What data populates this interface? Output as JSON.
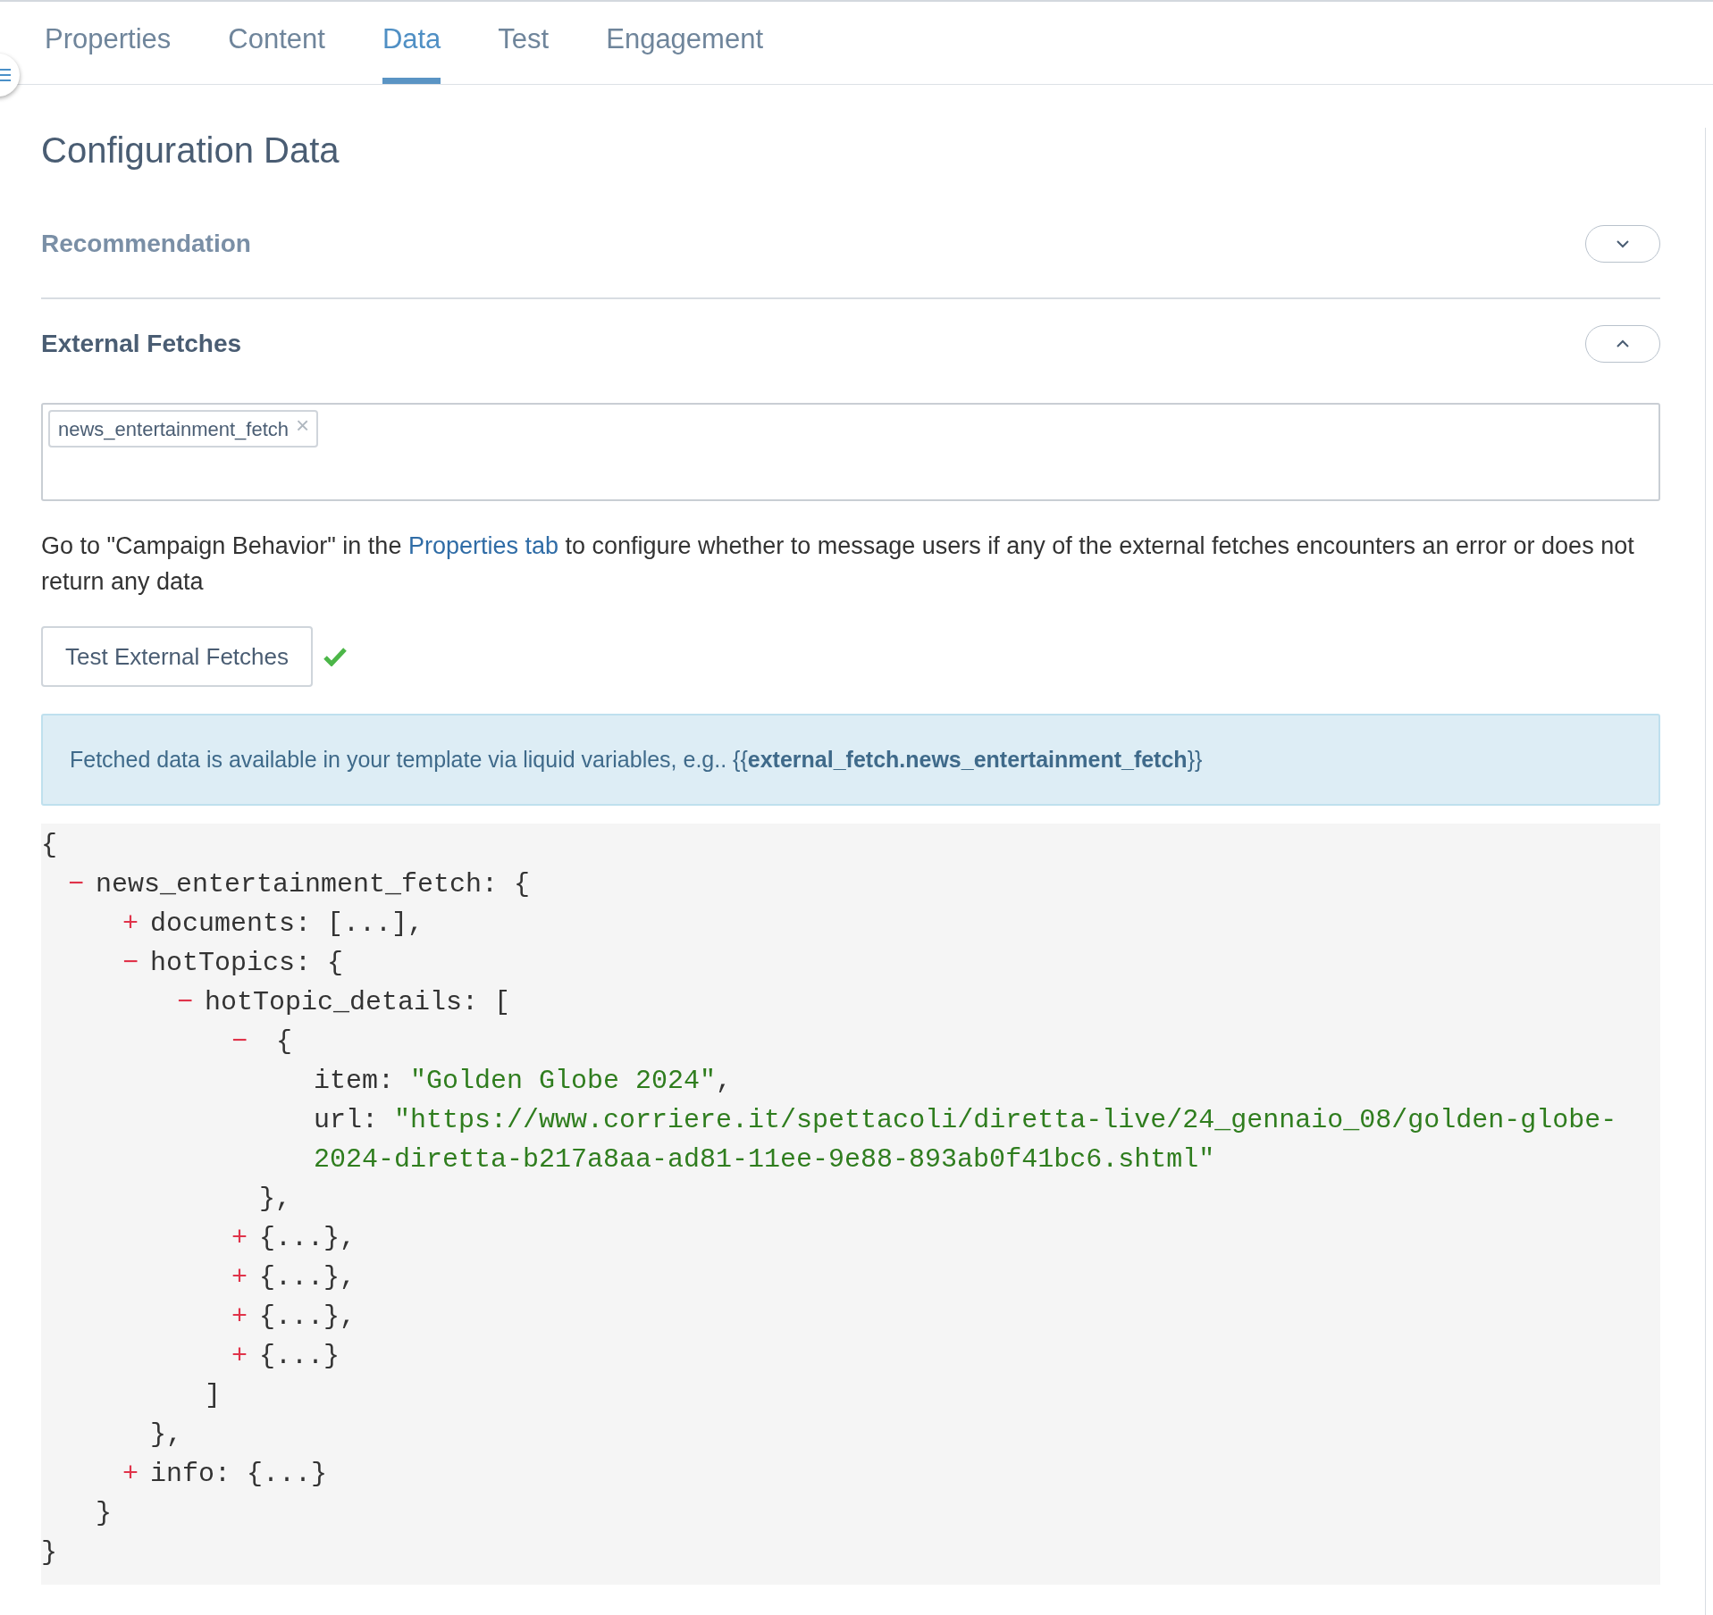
{
  "tabs": [
    {
      "label": "Properties",
      "selected": false
    },
    {
      "label": "Content",
      "selected": false
    },
    {
      "label": "Data",
      "selected": true
    },
    {
      "label": "Test",
      "selected": false
    },
    {
      "label": "Engagement",
      "selected": false
    }
  ],
  "page_title": "Configuration Data",
  "sections": [
    {
      "title": "Recommendation",
      "expanded": false
    },
    {
      "title": "External Fetches",
      "expanded": true
    }
  ],
  "fetch_tags": [
    {
      "label": "news_entertainment_fetch",
      "remove": "×"
    }
  ],
  "help": {
    "before": "Go to \"Campaign Behavior\" in the ",
    "link": "Properties tab",
    "after": " to configure whether to message users if any of the external fetches encounters an error or does not return any data"
  },
  "test_button": {
    "label": "Test External Fetches",
    "passed": true
  },
  "info_banner": "Fetched data is available in your template via liquid variables, e.g.. {{**external_fetch.news_entertainment_fetch**}}",
  "code": {
    "open": "{",
    "close": "}",
    "children": [
      {
        "toggle": "−",
        "label": "news_entertainment_fetch: {",
        "expanded": true,
        "close": "}",
        "children": [
          {
            "toggle": "+",
            "label": "documents: [...],",
            "expanded": false
          },
          {
            "toggle": "−",
            "label": "hotTopics: {",
            "expanded": true,
            "close": "},",
            "children": [
              {
                "toggle": "−",
                "label": "hotTopic_details: [",
                "expanded": true,
                "close": "]",
                "children": [
                  {
                    "toggle": "−",
                    "label": "{",
                    "expanded": true,
                    "close": "},",
                    "children": [
                      {
                        "key": "item:",
                        "value": "\"Golden Globe 2024\"",
                        "after": ","
                      },
                      {
                        "key": "url:",
                        "value": "\"https://www.corriere.it/spettacoli/diretta-live/24_gennaio_08/golden-globe-2024-diretta-b217a8aa-ad81-11ee-9e88-893ab0f41bc6.shtml\""
                      }
                    ]
                  },
                  {
                    "toggle": "+",
                    "label": "{...},",
                    "expanded": false
                  },
                  {
                    "toggle": "+",
                    "label": "{...},",
                    "expanded": false
                  },
                  {
                    "toggle": "+",
                    "label": "{...},",
                    "expanded": false
                  },
                  {
                    "toggle": "+",
                    "label": "{...}",
                    "expanded": false
                  }
                ]
              }
            ]
          },
          {
            "toggle": "+",
            "label": "info: {...}",
            "expanded": false
          }
        ]
      }
    ]
  }
}
